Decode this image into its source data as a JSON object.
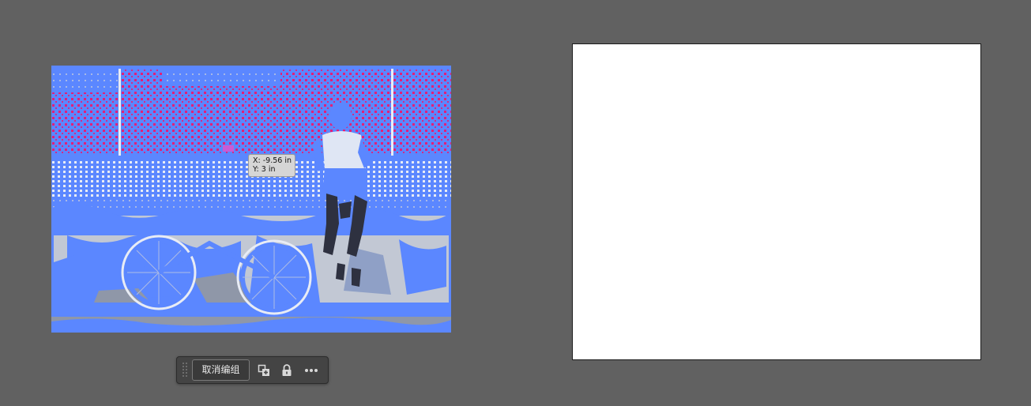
{
  "coordinate_readout": {
    "x_text": "X: -9.56 in",
    "y_text": "Y: 3 in"
  },
  "task_bar": {
    "ungroup_label": "取消编组",
    "icons": [
      "grip-handle-icon",
      "arrange-icon",
      "lock-icon",
      "more-options-icon"
    ]
  },
  "colors": {
    "workspace": "#616161",
    "artboard": "#ffffff",
    "image_blue": "#5b87ff",
    "image_magenta": "#e0207a",
    "image_light_gray": "#c2c8d4",
    "image_dark": "#2e3140",
    "taskbar_bg": "#444444"
  }
}
